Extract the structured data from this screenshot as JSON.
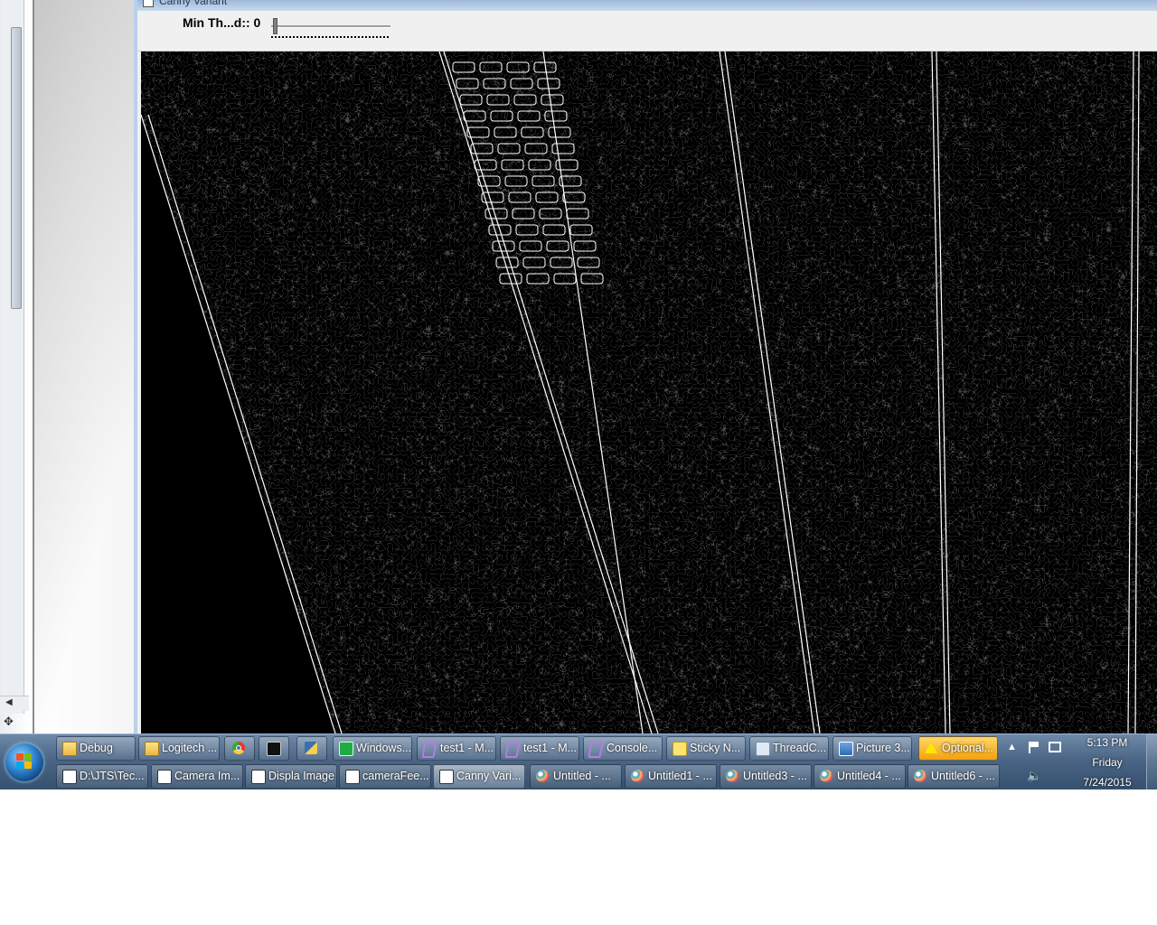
{
  "canny_window": {
    "title": "Canny Variant",
    "trackbar": {
      "label": "Min Th...d:: 0",
      "value": 0
    }
  },
  "taskbar": {
    "row1": [
      {
        "label": "Debug",
        "icon": "folder-icon"
      },
      {
        "label": "Logitech ...",
        "icon": "folder-icon"
      },
      {
        "label": "",
        "icon": "chrome-icon"
      },
      {
        "label": "",
        "icon": "command-prompt-icon"
      },
      {
        "label": "",
        "icon": "python-icon"
      },
      {
        "label": "Windows...",
        "icon": "monitor-icon"
      },
      {
        "label": "test1 - M...",
        "icon": "visual-studio-icon"
      },
      {
        "label": "test1 - M...",
        "icon": "visual-studio-icon"
      },
      {
        "label": "Console...",
        "icon": "visual-studio-icon"
      },
      {
        "label": "Sticky N...",
        "icon": "sticky-notes-icon"
      },
      {
        "label": "ThreadC...",
        "icon": "notepad-icon"
      },
      {
        "label": "Picture 3...",
        "icon": "picture-icon"
      },
      {
        "label": "Optional...",
        "icon": "warning-icon"
      }
    ],
    "row2": [
      {
        "label": "D:\\JTS\\Tec...",
        "icon": "window-icon"
      },
      {
        "label": "Camera Im...",
        "icon": "window-icon"
      },
      {
        "label": "Displa Image",
        "icon": "window-icon"
      },
      {
        "label": "cameraFee...",
        "icon": "window-icon"
      },
      {
        "label": "Canny Vari...",
        "icon": "window-icon"
      },
      {
        "label": "Untitled - ...",
        "icon": "paint-icon"
      },
      {
        "label": "Untitled1 - ...",
        "icon": "paint-icon"
      },
      {
        "label": "Untitled3 - ...",
        "icon": "paint-icon"
      },
      {
        "label": "Untitled4 - ...",
        "icon": "paint-icon"
      },
      {
        "label": "Untitled6 - ...",
        "icon": "paint-icon"
      }
    ],
    "clock": {
      "time": "5:13 PM",
      "day": "Friday",
      "date": "7/24/2015"
    }
  },
  "colors": {
    "taskbar": "#4a6585",
    "image_background": "#000000",
    "edges": "#ffffff",
    "alert": "#f2a20e"
  }
}
